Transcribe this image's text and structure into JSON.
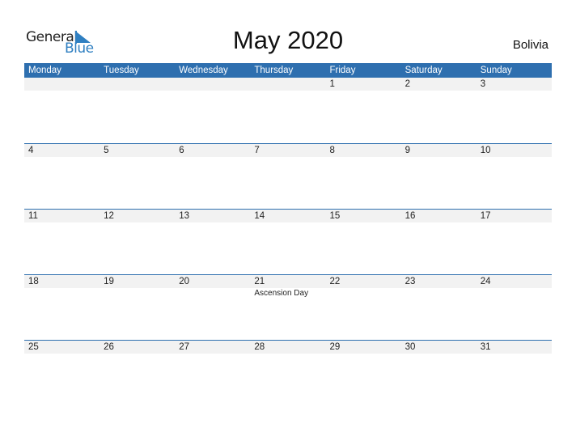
{
  "logo": {
    "general": "General",
    "blue": "Blue"
  },
  "title": "May 2020",
  "country": "Bolivia",
  "weekdays": [
    "Monday",
    "Tuesday",
    "Wednesday",
    "Thursday",
    "Friday",
    "Saturday",
    "Sunday"
  ],
  "weeks": [
    {
      "days": [
        "",
        "",
        "",
        "",
        "1",
        "2",
        "3"
      ],
      "events": [
        "",
        "",
        "",
        "",
        "",
        "",
        ""
      ]
    },
    {
      "days": [
        "4",
        "5",
        "6",
        "7",
        "8",
        "9",
        "10"
      ],
      "events": [
        "",
        "",
        "",
        "",
        "",
        "",
        ""
      ]
    },
    {
      "days": [
        "11",
        "12",
        "13",
        "14",
        "15",
        "16",
        "17"
      ],
      "events": [
        "",
        "",
        "",
        "",
        "",
        "",
        ""
      ]
    },
    {
      "days": [
        "18",
        "19",
        "20",
        "21",
        "22",
        "23",
        "24"
      ],
      "events": [
        "",
        "",
        "",
        "Ascension Day",
        "",
        "",
        ""
      ]
    },
    {
      "days": [
        "25",
        "26",
        "27",
        "28",
        "29",
        "30",
        "31"
      ],
      "events": [
        "",
        "",
        "",
        "",
        "",
        "",
        ""
      ]
    }
  ]
}
